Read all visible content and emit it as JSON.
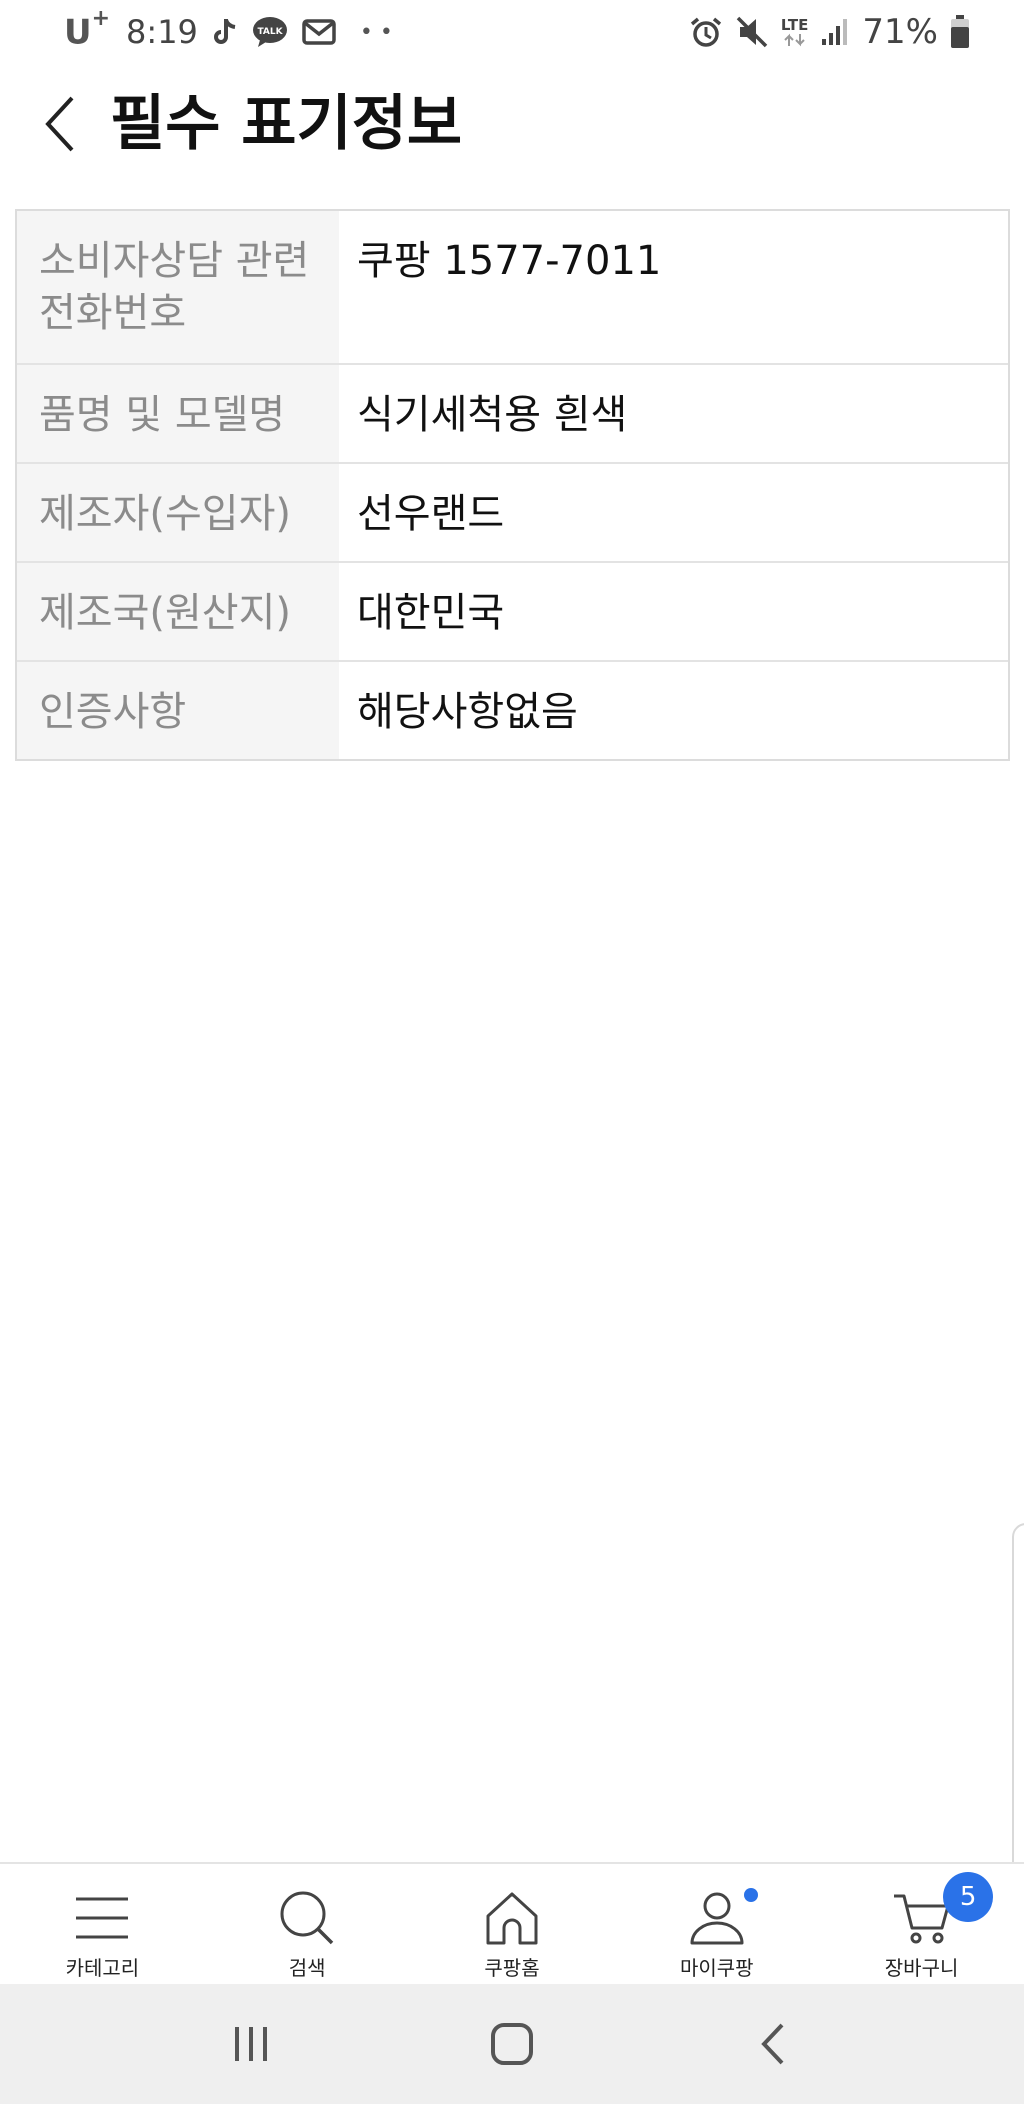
{
  "status_bar": {
    "carrier": "U",
    "carrier_sup": "+",
    "time": "8:19",
    "more": "• •",
    "network": "LTE",
    "battery": "71%"
  },
  "header": {
    "title": "필수 표기정보"
  },
  "info": {
    "rows": [
      {
        "key": "소비자상담 관련 전화번호",
        "value": "쿠팡 1577-7011"
      },
      {
        "key": "품명 및 모델명",
        "value": "식기세척용 흰색"
      },
      {
        "key": "제조자(수입자)",
        "value": "선우랜드"
      },
      {
        "key": "제조국(원산지)",
        "value": "대한민국"
      },
      {
        "key": "인증사항",
        "value": "해당사항없음"
      }
    ]
  },
  "bottom_nav": {
    "items": [
      {
        "label": "카테고리",
        "icon": "menu-icon"
      },
      {
        "label": "검색",
        "icon": "search-icon"
      },
      {
        "label": "쿠팡홈",
        "icon": "home-icon"
      },
      {
        "label": "마이쿠팡",
        "icon": "person-icon"
      },
      {
        "label": "장바구니",
        "icon": "cart-icon"
      }
    ],
    "cart_count": "5",
    "accent_color": "#2a72e8"
  }
}
